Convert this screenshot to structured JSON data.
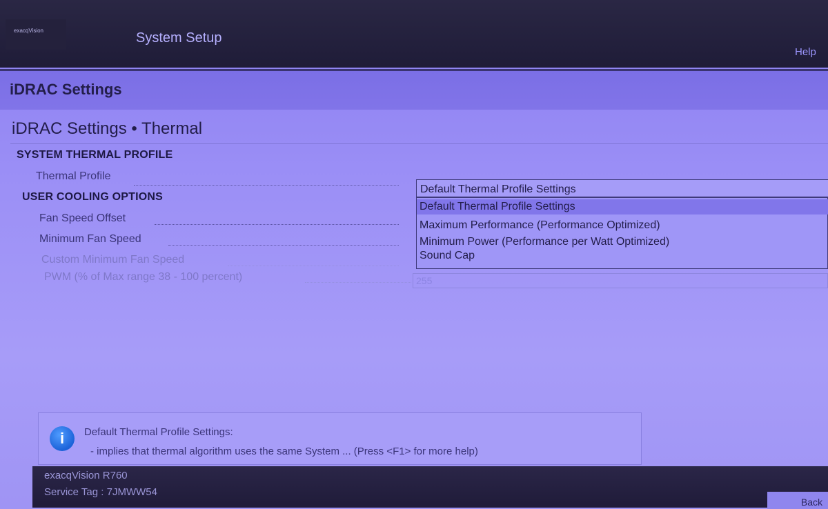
{
  "header": {
    "brand": "exacqVision",
    "title": "System Setup",
    "help_label": "Help"
  },
  "section": {
    "title": "iDRAC Settings"
  },
  "page": {
    "title": "iDRAC Settings • Thermal"
  },
  "groups": {
    "system_thermal_profile": "SYSTEM THERMAL PROFILE",
    "user_cooling_options": "USER COOLING OPTIONS"
  },
  "fields": {
    "thermal_profile": "Thermal Profile",
    "fan_speed_offset": "Fan Speed Offset",
    "minimum_fan_speed": "Minimum Fan Speed",
    "custom_min_fan_speed": "Custom Minimum Fan Speed",
    "pwm": "PWM (% of Max range 38 - 100 percent)"
  },
  "thermal_dropdown": {
    "selected": "Default Thermal Profile Settings",
    "options": [
      "Default Thermal Profile Settings",
      "Maximum Performance (Performance Optimized)",
      "Minimum Power (Performance per Watt Optimized)",
      "Sound Cap"
    ]
  },
  "pwm_value": "255",
  "info": {
    "title": "Default Thermal Profile Settings:",
    "description": "- implies that thermal algorithm uses the same System ... (Press <F1> for more help)"
  },
  "footer": {
    "model": "exacqVision R760",
    "service_tag": "Service Tag : 7JMWW54",
    "back_label": "Back"
  },
  "colors": {
    "accent": "#8176ea",
    "info_icon": "#1c63d9",
    "header_bg": "#1f1c38"
  }
}
